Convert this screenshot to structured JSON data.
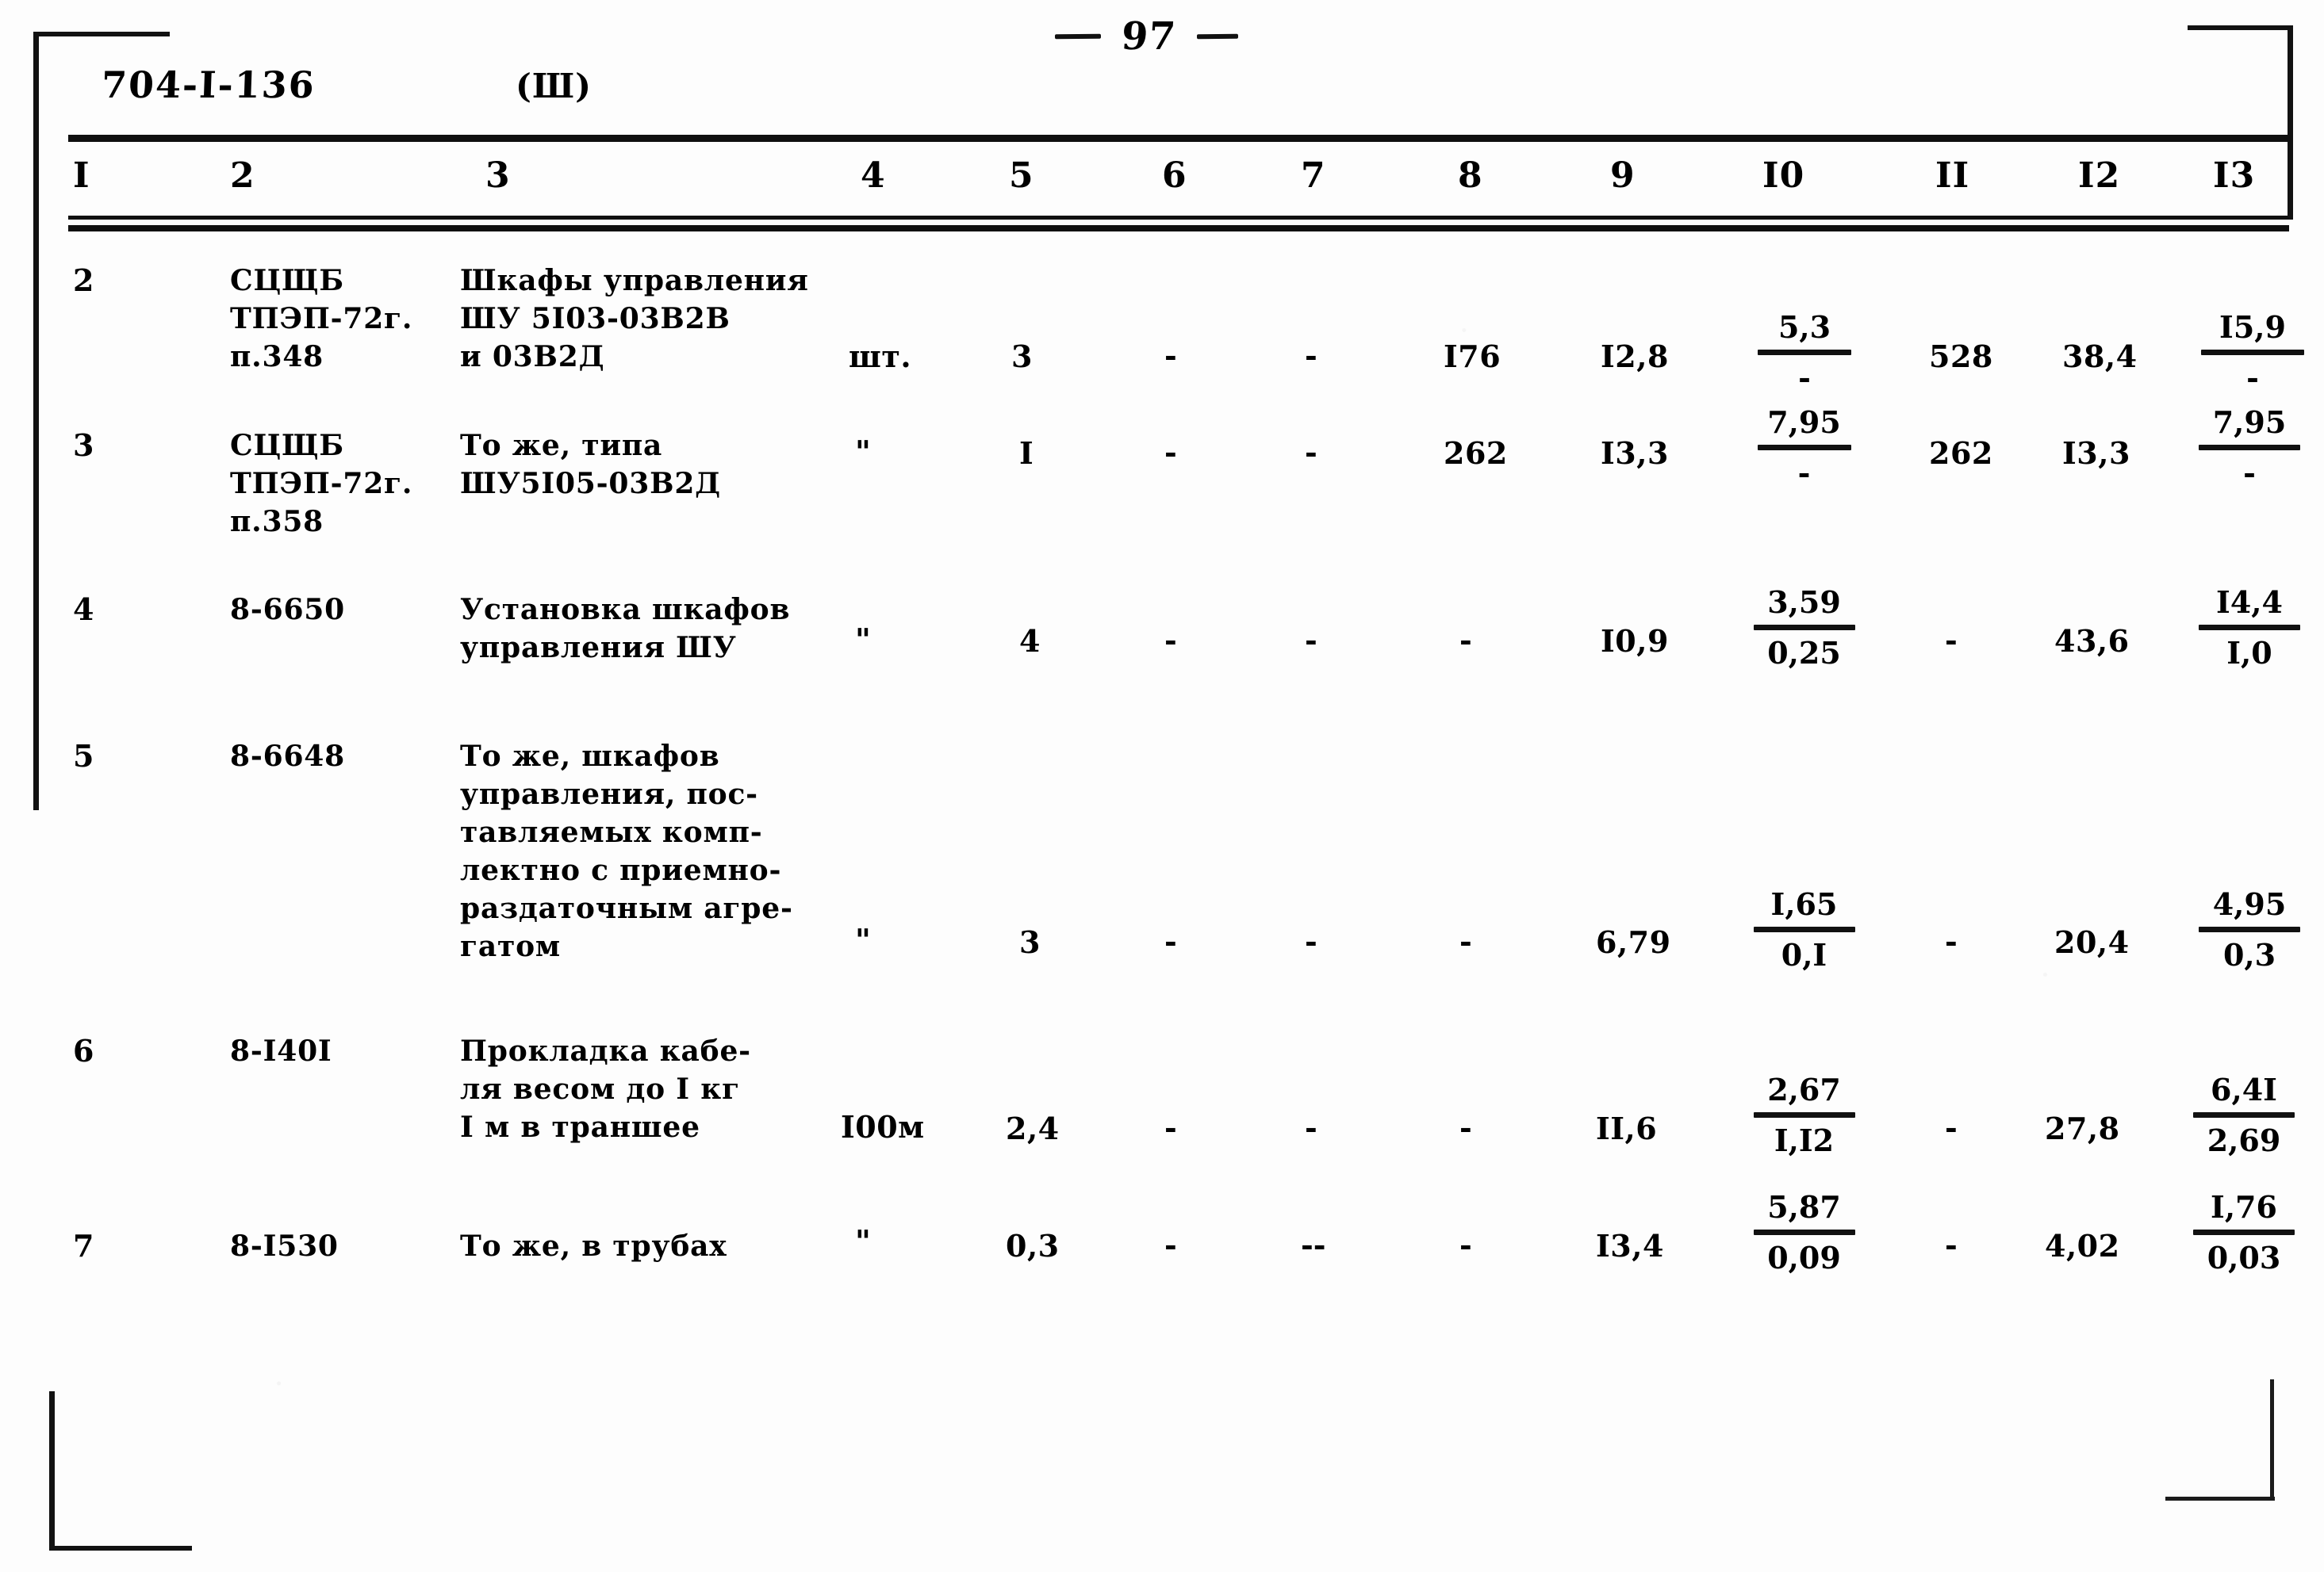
{
  "page": {
    "page_number": "97",
    "doc_code": "704-I-136",
    "variant": "(Ш)"
  },
  "table": {
    "column_headers": [
      "I",
      "2",
      "3",
      "4",
      "5",
      "6",
      "7",
      "8",
      "9",
      "I0",
      "II",
      "I2",
      "I3"
    ],
    "rows": [
      {
        "c1": "2",
        "c2": "СЦЩБ\nТПЭП-72г.\nп.348",
        "c3": "Шкафы управления\nШУ 5I03-03В2В\nи 03В2Д",
        "c4": "шт.",
        "c5": "3",
        "c6": "-",
        "c7": "-",
        "c8": "I76",
        "c9": "I2,8",
        "c10_top": "5,3",
        "c10_bot": "-",
        "c11": "528",
        "c12": "38,4",
        "c13_top": "I5,9",
        "c13_bot": "-"
      },
      {
        "c1": "3",
        "c2": "СЦЩБ\nТПЭП-72г.\nп.358",
        "c3": "То же, типа\nШУ5I05-03В2Д",
        "c4": "\"",
        "c5": "I",
        "c6": "-",
        "c7": "-",
        "c8": "262",
        "c9": "I3,3",
        "c10_top": "7,95",
        "c10_bot": "-",
        "c11": "262",
        "c12": "I3,3",
        "c13_top": "7,95",
        "c13_bot": "-"
      },
      {
        "c1": "4",
        "c2": "8-6650",
        "c3": "Установка шкафов\nуправления ШУ",
        "c4": "\"",
        "c5": "4",
        "c6": "-",
        "c7": "-",
        "c8": "-",
        "c9": "I0,9",
        "c10_top": "3,59",
        "c10_bot": "0,25",
        "c11": "-",
        "c12": "43,6",
        "c13_top": "I4,4",
        "c13_bot": "I,0"
      },
      {
        "c1": "5",
        "c2": "8-6648",
        "c3": "То же, шкафов\nуправления, пос-\nтавляемых комп-\nлектно с приемно-\nраздаточным агре-\nгатом",
        "c4": "\"",
        "c5": "3",
        "c6": "-",
        "c7": "-",
        "c8": "-",
        "c9": "6,79",
        "c10_top": "I,65",
        "c10_bot": "0,I",
        "c11": "-",
        "c12": "20,4",
        "c13_top": "4,95",
        "c13_bot": "0,3"
      },
      {
        "c1": "6",
        "c2": "8-I40I",
        "c3": "Прокладка кабе-\nля весом до I кг\nI м в траншее",
        "c4": "I00м",
        "c5": "2,4",
        "c6": "-",
        "c7": "-",
        "c8": "-",
        "c9": "II,6",
        "c10_top": "2,67",
        "c10_bot": "I,I2",
        "c11": "-",
        "c12": "27,8",
        "c13_top": "6,4I",
        "c13_bot": "2,69"
      },
      {
        "c1": "7",
        "c2": "8-I530",
        "c3": "То же, в трубах",
        "c4": "\"",
        "c5": "0,3",
        "c6": "-",
        "c7": "--",
        "c8": "-",
        "c9": "I3,4",
        "c10_top": "5,87",
        "c10_bot": "0,09",
        "c11": "-",
        "c12": "4,02",
        "c13_top": "I,76",
        "c13_bot": "0,03"
      }
    ]
  }
}
